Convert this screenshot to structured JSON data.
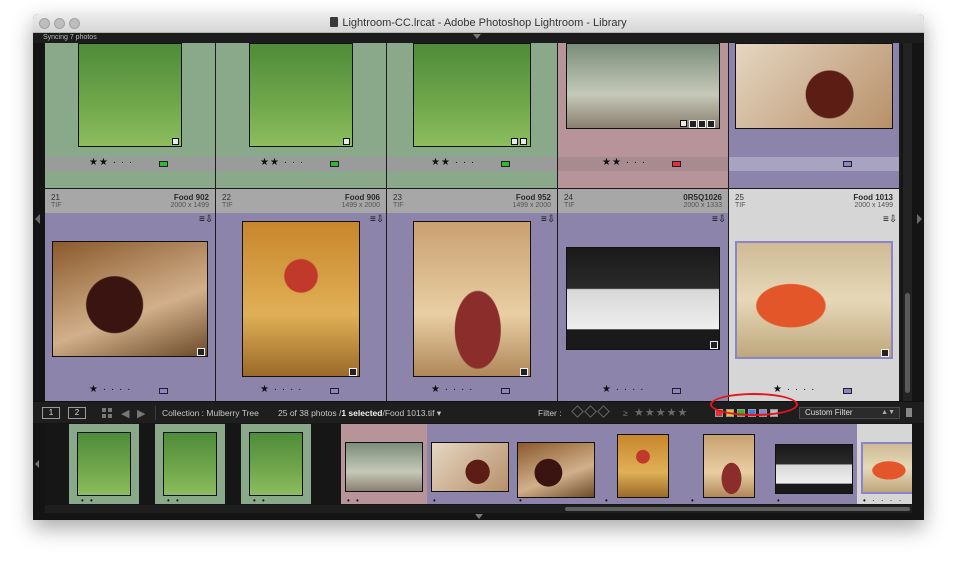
{
  "window": {
    "title": "Lightroom-CC.lrcat - Adobe Photoshop Lightroom - Library",
    "sync_status": "Syncing 7 photos"
  },
  "colors": {
    "green_bg": "#8aa88a",
    "purple_bg": "#8c84aa",
    "pink_bg": "#b6949a",
    "grey_bg": "#b7b7b7",
    "light_bg": "#d6d6d6",
    "green_label": "#33b633",
    "red_label": "#e0303a",
    "purple_label": "#8c84c8",
    "highlight_ring": "#e8141c"
  },
  "grid": {
    "top_row": [
      {
        "stars": "★★ · · ·",
        "label": "green",
        "rating": 2
      },
      {
        "stars": "★★ · · ·",
        "label": "green",
        "rating": 2
      },
      {
        "stars": "★★ · · ·",
        "label": "green",
        "rating": 2
      },
      {
        "stars": "★★ · · ·",
        "label": "red",
        "rating": 2
      },
      {
        "stars": "",
        "label": "purple",
        "rating": 0
      }
    ],
    "bottom_row": [
      {
        "num": "21",
        "name": "Food 902",
        "ext": "TIF",
        "dim": "2000 x 1499",
        "stars": "★ · · · ·",
        "label": "purple",
        "rating": 1
      },
      {
        "num": "22",
        "name": "Food 906",
        "ext": "TIF",
        "dim": "1499 x 2000",
        "stars": "★ · · · ·",
        "label": "purple",
        "rating": 1
      },
      {
        "num": "23",
        "name": "Food 952",
        "ext": "TIF",
        "dim": "1499 x 2000",
        "stars": "★ · · · ·",
        "label": "purple",
        "rating": 1
      },
      {
        "num": "24",
        "name": "0R5Q1026",
        "ext": "TIF",
        "dim": "2000 x 1333",
        "stars": "★ · · · ·",
        "label": "purple",
        "rating": 1
      },
      {
        "num": "25",
        "name": "Food 1013",
        "ext": "TIF",
        "dim": "2000 x 1499",
        "stars": "★ · · · ·",
        "label": "purple",
        "rating": 1
      }
    ]
  },
  "toolbar": {
    "page1": "1",
    "page2": "2",
    "collection_prefix": "Collection : ",
    "collection_name": "Mulberry Tree",
    "photo_count": "25 of 38 photos /",
    "selected": "1 selected",
    "selected_file": "/Food 1013.tif",
    "filter_label": "Filter :",
    "filter_compare": "≥",
    "filter_stars": "★★★★★",
    "custom_filter": "Custom Filter",
    "color_filters": [
      "#e0303a",
      "#e6c23a",
      "#33b633",
      "#4a7be0",
      "#8c84c8",
      "#bdbdbd"
    ]
  },
  "filmstrip": {
    "thumbs": [
      {
        "bg": "green",
        "art": "people",
        "dots": "• •"
      },
      {
        "bg": "green",
        "art": "people",
        "dots": "• •"
      },
      {
        "bg": "green",
        "art": "people",
        "dots": "• •"
      },
      {
        "bg": "pink",
        "art": "terrace",
        "dots": "• •"
      },
      {
        "bg": "purple",
        "art": "dessert",
        "dots": "•"
      },
      {
        "bg": "purple",
        "art": "cake",
        "dots": "•"
      },
      {
        "bg": "purple",
        "art": "glass",
        "dots": "•"
      },
      {
        "bg": "purple",
        "art": "meat",
        "dots": "•"
      },
      {
        "bg": "purple",
        "art": "cutlery",
        "dots": "•"
      },
      {
        "bg": "light",
        "art": "salmon",
        "dots": "• · · · ·"
      }
    ]
  }
}
